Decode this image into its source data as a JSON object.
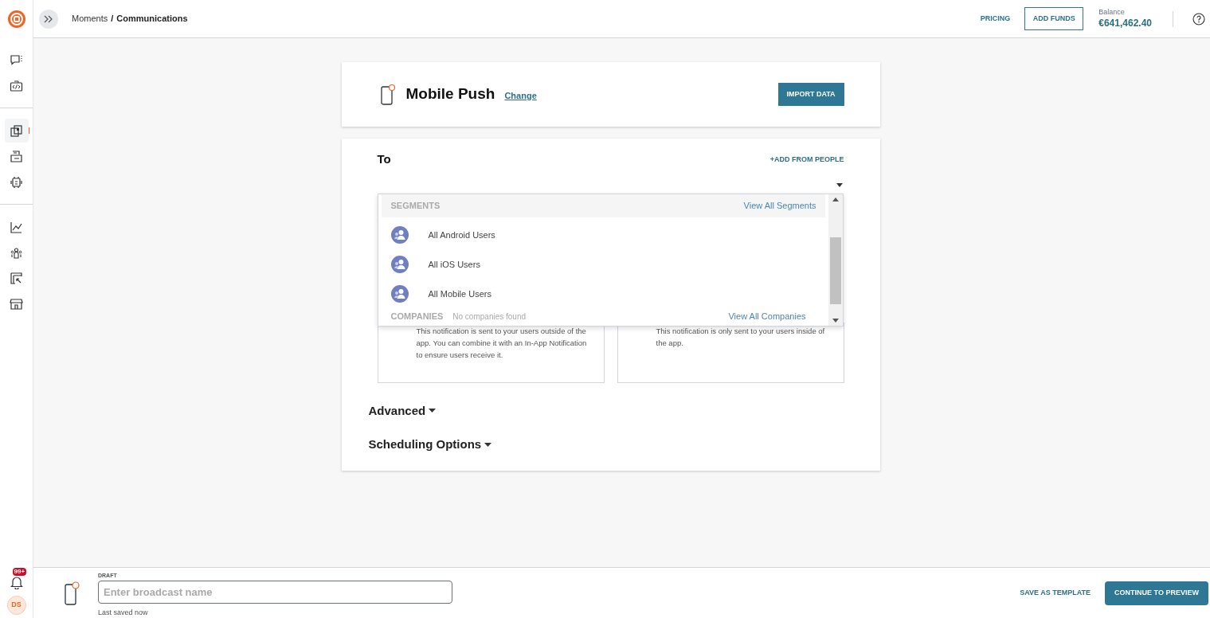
{
  "header": {
    "breadcrumb_parent": "Moments",
    "breadcrumb_separator": "/",
    "breadcrumb_current": "Communications",
    "pricing": "PRICING",
    "add_funds": "ADD FUNDS",
    "balance_label": "Balance",
    "balance": "€641,462.40"
  },
  "sidebar": {
    "groups": [
      [
        {
          "kind": "chat",
          "selected": false
        },
        {
          "kind": "code",
          "selected": false
        }
      ],
      [
        {
          "kind": "copy",
          "selected": true
        },
        {
          "kind": "inbox",
          "selected": false
        },
        {
          "kind": "robot",
          "selected": false
        }
      ],
      [
        {
          "kind": "chart",
          "selected": false
        },
        {
          "kind": "people",
          "selected": false
        },
        {
          "kind": "cursor",
          "selected": false
        },
        {
          "kind": "store",
          "selected": false
        }
      ]
    ],
    "notifications": "99+",
    "avatar": "DS"
  },
  "channel": {
    "title": "Mobile Push",
    "change": "Change",
    "import": "IMPORT DATA"
  },
  "to": {
    "label": "To",
    "add_from_people": "+ADD FROM PEOPLE"
  },
  "dropdown": {
    "segments_heading": "SEGMENTS",
    "view_all_segments": "View All Segments",
    "segments": [
      "All Android Users",
      "All iOS Users",
      "All Mobile Users"
    ],
    "companies_heading": "COMPANIES",
    "companies_empty": "No companies found",
    "view_all_companies": "View All Companies"
  },
  "cards": [
    {
      "lines": [
        "This notification is sent to your users outside of the",
        "app. You can combine it with an In-App Notification",
        "to ensure users receive it."
      ]
    },
    {
      "lines": [
        "This notification is only sent to your users inside of",
        "the app."
      ]
    }
  ],
  "sections": [
    {
      "label": "Advanced",
      "expanded": false
    },
    {
      "label": "Scheduling Options",
      "expanded": false
    }
  ],
  "footer": {
    "draft_label": "DRAFT",
    "name_placeholder": "Enter broadcast name",
    "last_saved": "Last saved now",
    "save_template": "SAVE AS TEMPLATE",
    "continue": "CONTINUE TO PREVIEW"
  }
}
